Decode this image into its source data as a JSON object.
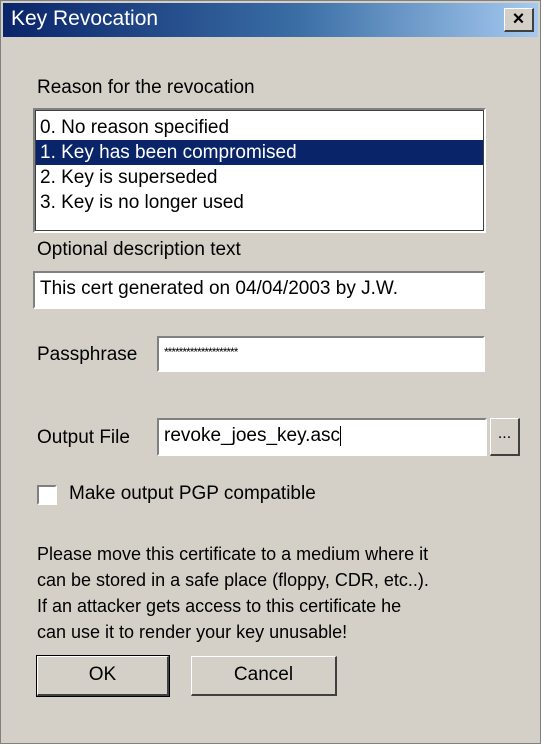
{
  "window": {
    "title": "Key Revocation",
    "close_label": "×"
  },
  "reason": {
    "label": "Reason for the revocation",
    "options": [
      "0. No reason specified",
      "1. Key has been compromised",
      "2. Key is superseded",
      "3. Key is no longer used"
    ],
    "selected_index": 1
  },
  "description": {
    "label": "Optional description text",
    "value": "This cert generated on 04/04/2003 by J.W."
  },
  "passphrase": {
    "label": "Passphrase",
    "value": "********************"
  },
  "output_file": {
    "label": "Output File",
    "value": "revoke_joes_key.asc",
    "browse_label": "..."
  },
  "pgp_compatible": {
    "label": "Make output PGP compatible",
    "checked": false
  },
  "info": {
    "lines": [
      "Please move this certificate to a medium where it",
      "can be stored in a safe place (floppy, CDR, etc..).",
      "If an attacker gets access to this certificate he",
      "can use it to render your key unusable!"
    ]
  },
  "buttons": {
    "ok": "OK",
    "cancel": "Cancel"
  },
  "colors": {
    "dialog_bg": "#d4d0c8",
    "title_start": "#0a246a",
    "title_end": "#a6caf0",
    "selection_bg": "#0a246a",
    "selection_fg": "#ffffff"
  }
}
